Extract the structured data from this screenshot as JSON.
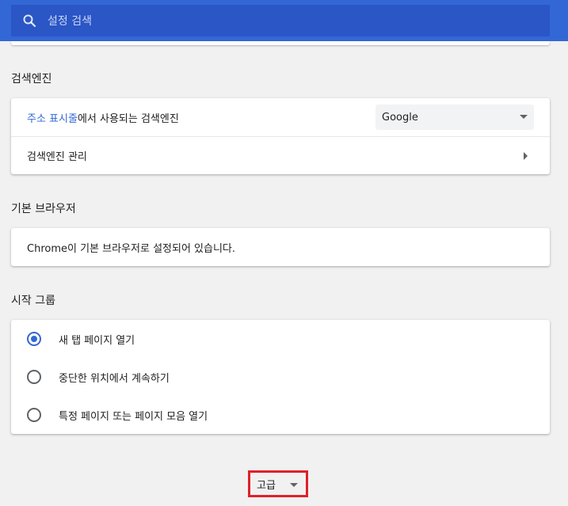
{
  "search": {
    "placeholder": "설정 검색",
    "icon": "search-icon"
  },
  "search_engine_section": {
    "title": "검색엔진",
    "row1": {
      "link_text": "주소 표시줄",
      "suffix_text": "에서 사용되는 검색엔진",
      "dropdown_value": "Google"
    },
    "row2": {
      "label": "검색엔진 관리"
    }
  },
  "default_browser_section": {
    "title": "기본 브라우저",
    "status_text": "Chrome이 기본 브라우저로 설정되어 있습니다."
  },
  "startup_section": {
    "title": "시작 그룹",
    "options": [
      {
        "label": "새 탭 페이지 열기",
        "checked": true
      },
      {
        "label": "중단한 위치에서 계속하기",
        "checked": false
      },
      {
        "label": "특정 페이지 또는 페이지 모음 열기",
        "checked": false
      }
    ]
  },
  "advanced": {
    "label": "고급"
  },
  "colors": {
    "header": "#3367d6",
    "search_box": "#2a56c6",
    "accent": "#3367d6",
    "highlight_border": "#e0202a"
  }
}
